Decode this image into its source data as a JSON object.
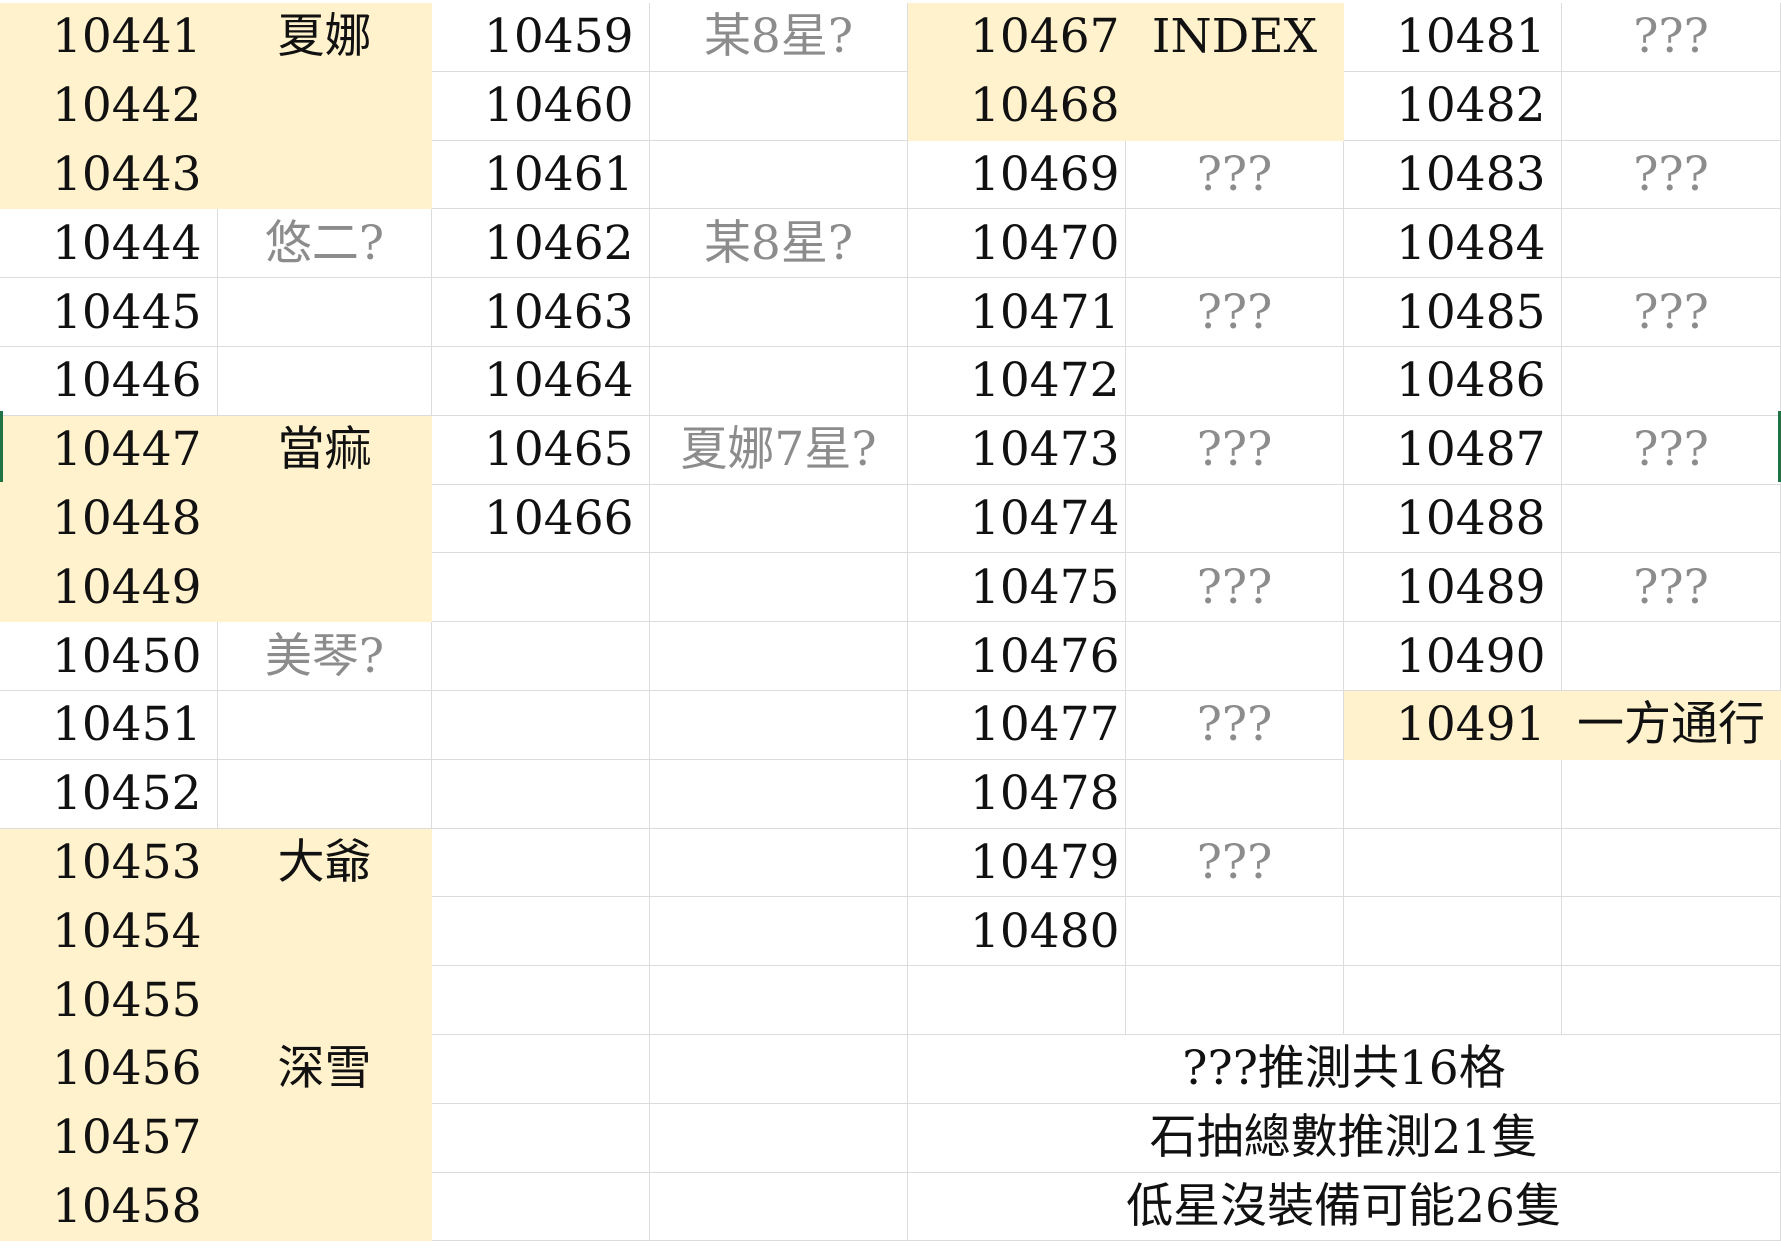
{
  "colors": {
    "highlight": "#fff2cc",
    "grid": "#dcdcdc",
    "text": "#111111",
    "muted": "#8c8c8c",
    "selection": "#217346"
  },
  "columns": [
    {
      "rows": [
        {
          "num": "10441",
          "label": "夏娜",
          "tone": "dark",
          "hl": true
        },
        {
          "num": "10442",
          "label": "",
          "tone": "dark",
          "hl": true
        },
        {
          "num": "10443",
          "label": "",
          "tone": "dark",
          "hl": true
        },
        {
          "num": "10444",
          "label": "悠二?",
          "tone": "gray",
          "hl": false
        },
        {
          "num": "10445",
          "label": "",
          "tone": "gray",
          "hl": false
        },
        {
          "num": "10446",
          "label": "",
          "tone": "gray",
          "hl": false
        },
        {
          "num": "10447",
          "label": "當痲",
          "tone": "dark",
          "hl": true
        },
        {
          "num": "10448",
          "label": "",
          "tone": "dark",
          "hl": true
        },
        {
          "num": "10449",
          "label": "",
          "tone": "dark",
          "hl": true
        },
        {
          "num": "10450",
          "label": "美琴?",
          "tone": "gray",
          "hl": false
        },
        {
          "num": "10451",
          "label": "",
          "tone": "gray",
          "hl": false
        },
        {
          "num": "10452",
          "label": "",
          "tone": "gray",
          "hl": false
        },
        {
          "num": "10453",
          "label": "大爺",
          "tone": "dark",
          "hl": true
        },
        {
          "num": "10454",
          "label": "",
          "tone": "dark",
          "hl": true
        },
        {
          "num": "10455",
          "label": "",
          "tone": "dark",
          "hl": true
        },
        {
          "num": "10456",
          "label": "深雪",
          "tone": "dark",
          "hl": true
        },
        {
          "num": "10457",
          "label": "",
          "tone": "dark",
          "hl": true
        },
        {
          "num": "10458",
          "label": "",
          "tone": "dark",
          "hl": true
        }
      ]
    },
    {
      "rows": [
        {
          "num": "10459",
          "label": "某8星?",
          "tone": "gray",
          "hl": false
        },
        {
          "num": "10460",
          "label": "",
          "tone": "gray",
          "hl": false
        },
        {
          "num": "10461",
          "label": "",
          "tone": "gray",
          "hl": false
        },
        {
          "num": "10462",
          "label": "某8星?",
          "tone": "gray",
          "hl": false
        },
        {
          "num": "10463",
          "label": "",
          "tone": "gray",
          "hl": false
        },
        {
          "num": "10464",
          "label": "",
          "tone": "gray",
          "hl": false
        },
        {
          "num": "10465",
          "label": "夏娜7星?",
          "tone": "gray",
          "hl": false
        },
        {
          "num": "10466",
          "label": "",
          "tone": "gray",
          "hl": false
        },
        {
          "num": "",
          "label": "",
          "tone": "gray",
          "hl": false
        },
        {
          "num": "",
          "label": "",
          "tone": "gray",
          "hl": false
        },
        {
          "num": "",
          "label": "",
          "tone": "gray",
          "hl": false
        },
        {
          "num": "",
          "label": "",
          "tone": "gray",
          "hl": false
        },
        {
          "num": "",
          "label": "",
          "tone": "gray",
          "hl": false
        },
        {
          "num": "",
          "label": "",
          "tone": "gray",
          "hl": false
        },
        {
          "num": "",
          "label": "",
          "tone": "gray",
          "hl": false
        },
        {
          "num": "",
          "label": "",
          "tone": "gray",
          "hl": false
        },
        {
          "num": "",
          "label": "",
          "tone": "gray",
          "hl": false
        },
        {
          "num": "",
          "label": "",
          "tone": "gray",
          "hl": false
        }
      ]
    },
    {
      "rows": [
        {
          "num": "10467",
          "label": "INDEX",
          "tone": "dark",
          "hl": true
        },
        {
          "num": "10468",
          "label": "",
          "tone": "dark",
          "hl": true
        },
        {
          "num": "10469",
          "label": "???",
          "tone": "gray",
          "hl": false
        },
        {
          "num": "10470",
          "label": "",
          "tone": "gray",
          "hl": false
        },
        {
          "num": "10471",
          "label": "???",
          "tone": "gray",
          "hl": false
        },
        {
          "num": "10472",
          "label": "",
          "tone": "gray",
          "hl": false
        },
        {
          "num": "10473",
          "label": "???",
          "tone": "gray",
          "hl": false
        },
        {
          "num": "10474",
          "label": "",
          "tone": "gray",
          "hl": false
        },
        {
          "num": "10475",
          "label": "???",
          "tone": "gray",
          "hl": false
        },
        {
          "num": "10476",
          "label": "",
          "tone": "gray",
          "hl": false
        },
        {
          "num": "10477",
          "label": "???",
          "tone": "gray",
          "hl": false
        },
        {
          "num": "10478",
          "label": "",
          "tone": "gray",
          "hl": false
        },
        {
          "num": "10479",
          "label": "???",
          "tone": "gray",
          "hl": false
        },
        {
          "num": "10480",
          "label": "",
          "tone": "gray",
          "hl": false
        },
        {
          "num": "",
          "label": "",
          "tone": "gray",
          "hl": false
        }
      ]
    },
    {
      "rows": [
        {
          "num": "10481",
          "label": "???",
          "tone": "gray",
          "hl": false
        },
        {
          "num": "10482",
          "label": "",
          "tone": "gray",
          "hl": false
        },
        {
          "num": "10483",
          "label": "???",
          "tone": "gray",
          "hl": false
        },
        {
          "num": "10484",
          "label": "",
          "tone": "gray",
          "hl": false
        },
        {
          "num": "10485",
          "label": "???",
          "tone": "gray",
          "hl": false
        },
        {
          "num": "10486",
          "label": "",
          "tone": "gray",
          "hl": false
        },
        {
          "num": "10487",
          "label": "???",
          "tone": "gray",
          "hl": false
        },
        {
          "num": "10488",
          "label": "",
          "tone": "gray",
          "hl": false
        },
        {
          "num": "10489",
          "label": "???",
          "tone": "gray",
          "hl": false
        },
        {
          "num": "10490",
          "label": "",
          "tone": "gray",
          "hl": false
        },
        {
          "num": "10491",
          "label": "一方通行",
          "tone": "dark",
          "hl": true
        },
        {
          "num": "",
          "label": "",
          "tone": "gray",
          "hl": false
        },
        {
          "num": "",
          "label": "",
          "tone": "gray",
          "hl": false
        },
        {
          "num": "",
          "label": "",
          "tone": "gray",
          "hl": false
        },
        {
          "num": "",
          "label": "",
          "tone": "gray",
          "hl": false
        }
      ]
    }
  ],
  "notes": [
    "???推測共16格",
    "石抽總數推測21隻",
    "低星沒裝備可能26隻"
  ]
}
